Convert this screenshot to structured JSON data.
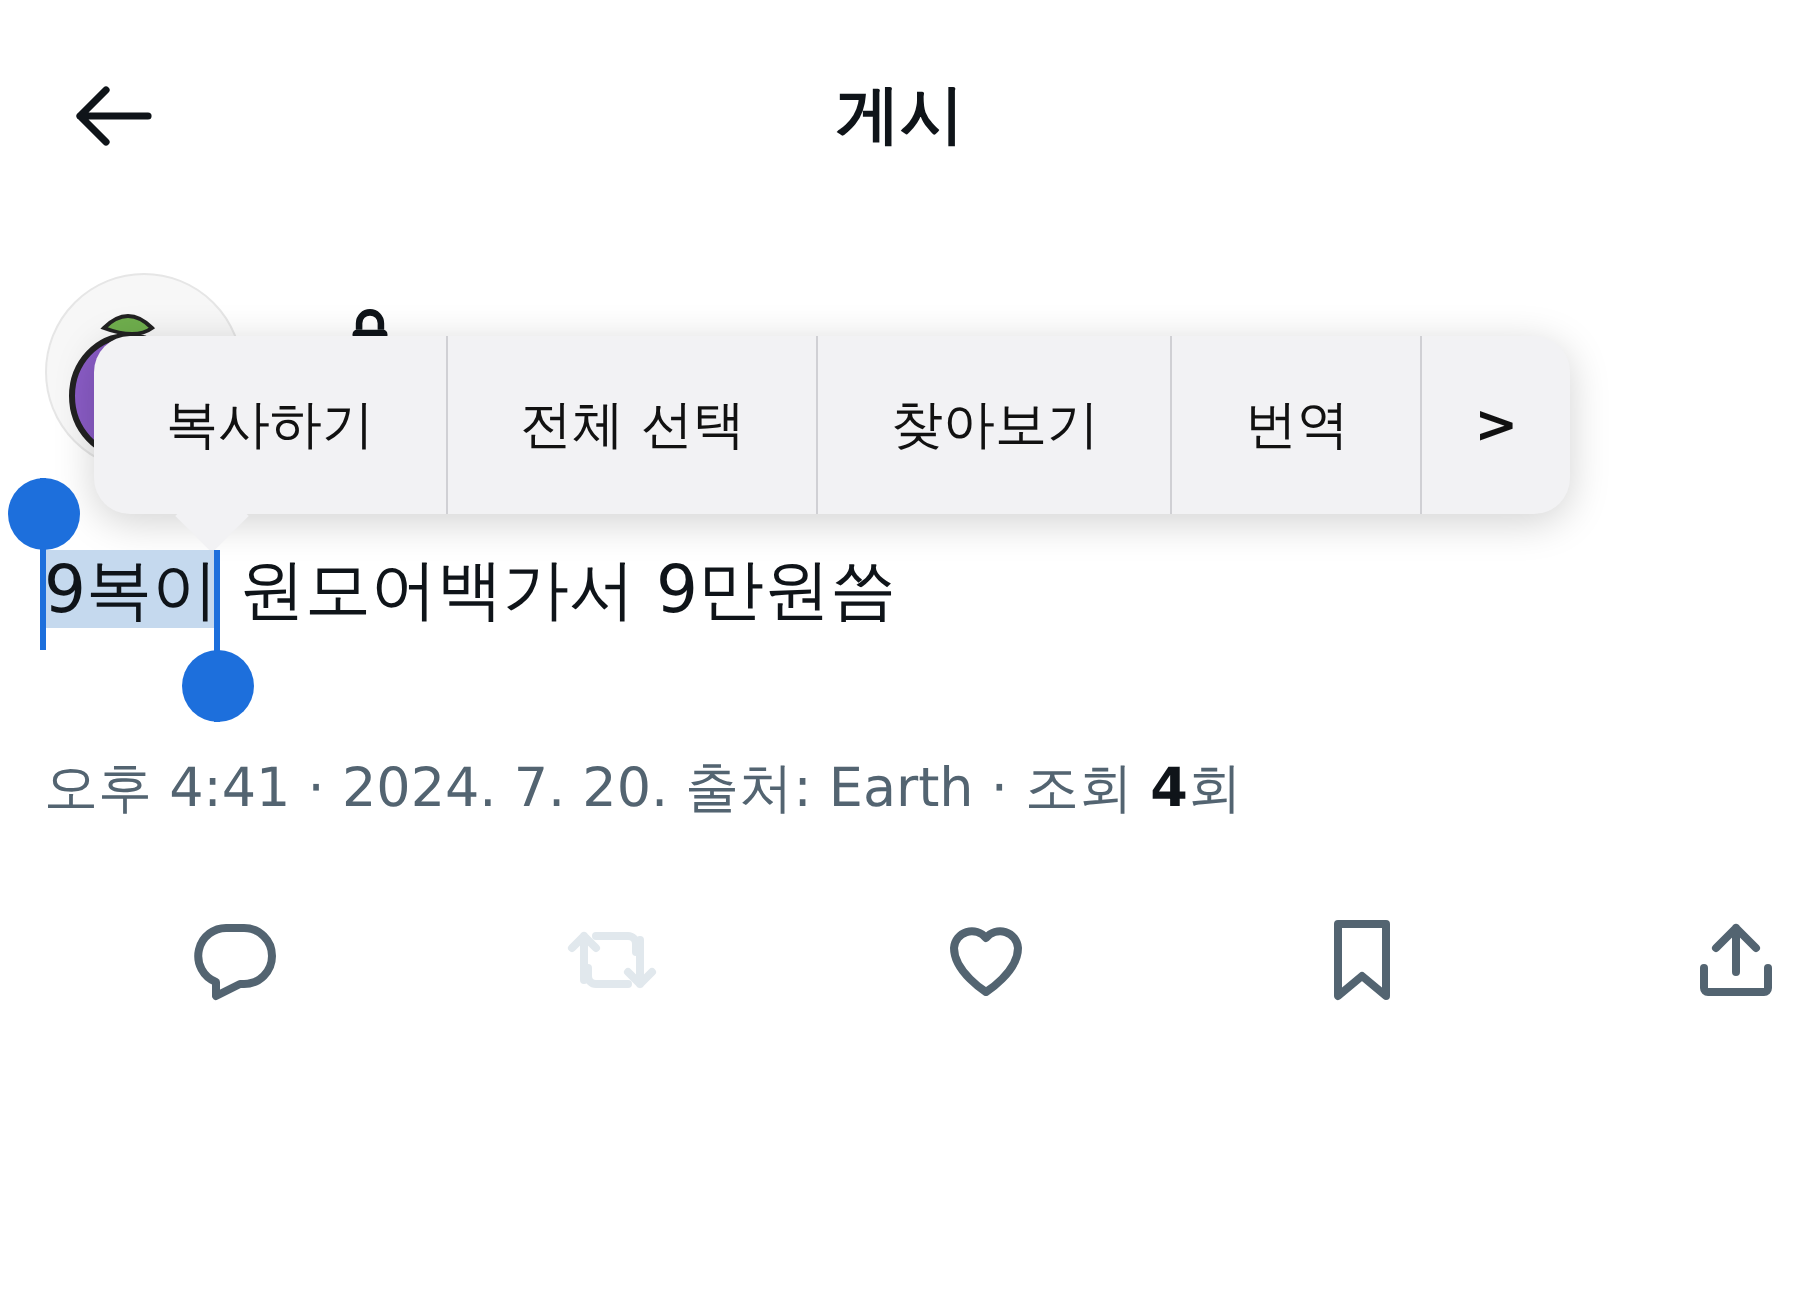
{
  "header": {
    "title": "게시"
  },
  "author": {
    "locked": true
  },
  "context_menu": {
    "items": [
      "복사하기",
      "전체 선택",
      "찾아보기",
      "번역"
    ],
    "more": ">"
  },
  "post": {
    "segments": [
      {
        "text": "9복이",
        "selected": true
      },
      {
        "text": " 원모어백가서 9만원씀",
        "selected": false
      }
    ]
  },
  "meta": "오후 4:41 · 2024. 7. 20. 출처: Earth · 조회 **4**회",
  "actions": [
    {
      "kind": "reply",
      "disabled": false
    },
    {
      "kind": "repost",
      "disabled": true
    },
    {
      "kind": "like",
      "disabled": false
    },
    {
      "kind": "bookmark",
      "disabled": false
    },
    {
      "kind": "share",
      "disabled": false
    }
  ]
}
